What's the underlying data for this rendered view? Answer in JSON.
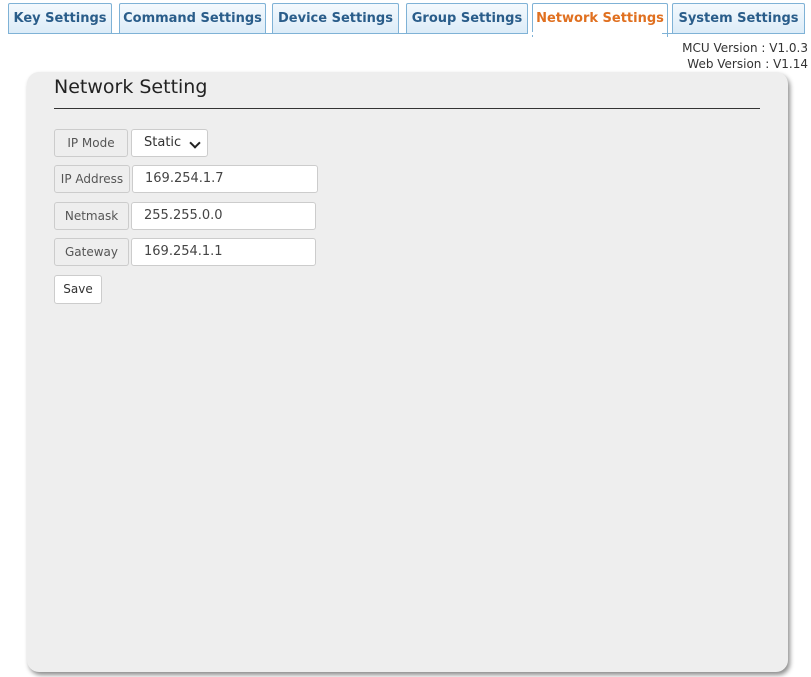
{
  "tabs": [
    {
      "label": "Key Settings"
    },
    {
      "label": "Command Settings"
    },
    {
      "label": "Device Settings"
    },
    {
      "label": "Group Settings"
    },
    {
      "label": "Network Settings",
      "active": true
    },
    {
      "label": "System Settings"
    }
  ],
  "versions": {
    "mcu": "MCU Version : V1.0.3",
    "web": "Web Version : V1.14"
  },
  "panel": {
    "title": "Network Setting",
    "fields": {
      "ip_mode": {
        "label": "IP Mode",
        "value": "Static"
      },
      "ip_address": {
        "label": "IP Address",
        "value": "169.254.1.7"
      },
      "netmask": {
        "label": "Netmask",
        "value": "255.255.0.0"
      },
      "gateway": {
        "label": "Gateway",
        "value": "169.254.1.1"
      }
    },
    "save_label": "Save"
  },
  "colors": {
    "tab_text": "#2a5d8a",
    "tab_active_text": "#e07020",
    "tab_border": "#7fb2d6",
    "panel_bg": "#eeeeee"
  },
  "icons": {
    "ip_mode_dropdown": "chevron-down-icon"
  }
}
